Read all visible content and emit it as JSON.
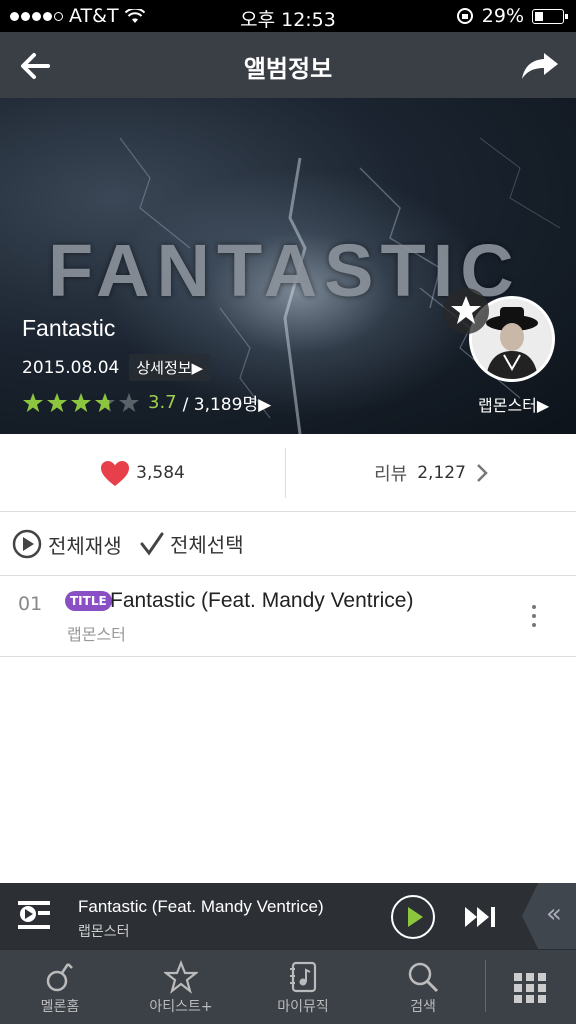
{
  "status_bar": {
    "carrier": "AT&T",
    "time": "오후 12:53",
    "battery": "29%",
    "battery_level": 0.29
  },
  "nav": {
    "title": "앨범정보"
  },
  "album": {
    "cover_text": "FANTASTIC",
    "title": "Fantastic",
    "release_date": "2015.08.04",
    "detail_label": "상세정보▶",
    "rating": 3.7,
    "rating_display": "3.7",
    "rating_count": "/ 3,189명▶",
    "artist_link": "랩몬스터▶"
  },
  "counts": {
    "likes": "3,584",
    "review_label": "리뷰",
    "review_count": "2,127"
  },
  "actions": {
    "play_all": "전체재생",
    "select_all": "전체선택"
  },
  "tracks": [
    {
      "number": "01",
      "badge": "TITLE",
      "title": "Fantastic (Feat. Mandy Ventrice)",
      "artist": "랩몬스터"
    }
  ],
  "mini_player": {
    "title": "Fantastic (Feat. Mandy Ventrice)",
    "artist": "랩몬스터"
  },
  "tabs": [
    {
      "label": "멜론홈",
      "icon": "melon-home-icon"
    },
    {
      "label": "아티스트+",
      "icon": "star-icon"
    },
    {
      "label": "마이뮤직",
      "icon": "my-music-icon"
    },
    {
      "label": "검색",
      "icon": "search-icon"
    }
  ],
  "colors": {
    "nav_bg": "#3a3f45",
    "rating_green": "#9fd04a",
    "star_green": "#8cc63f",
    "heart_red": "#e8404a",
    "title_badge": "#8a4fc4",
    "play_green": "#8cc63f"
  }
}
